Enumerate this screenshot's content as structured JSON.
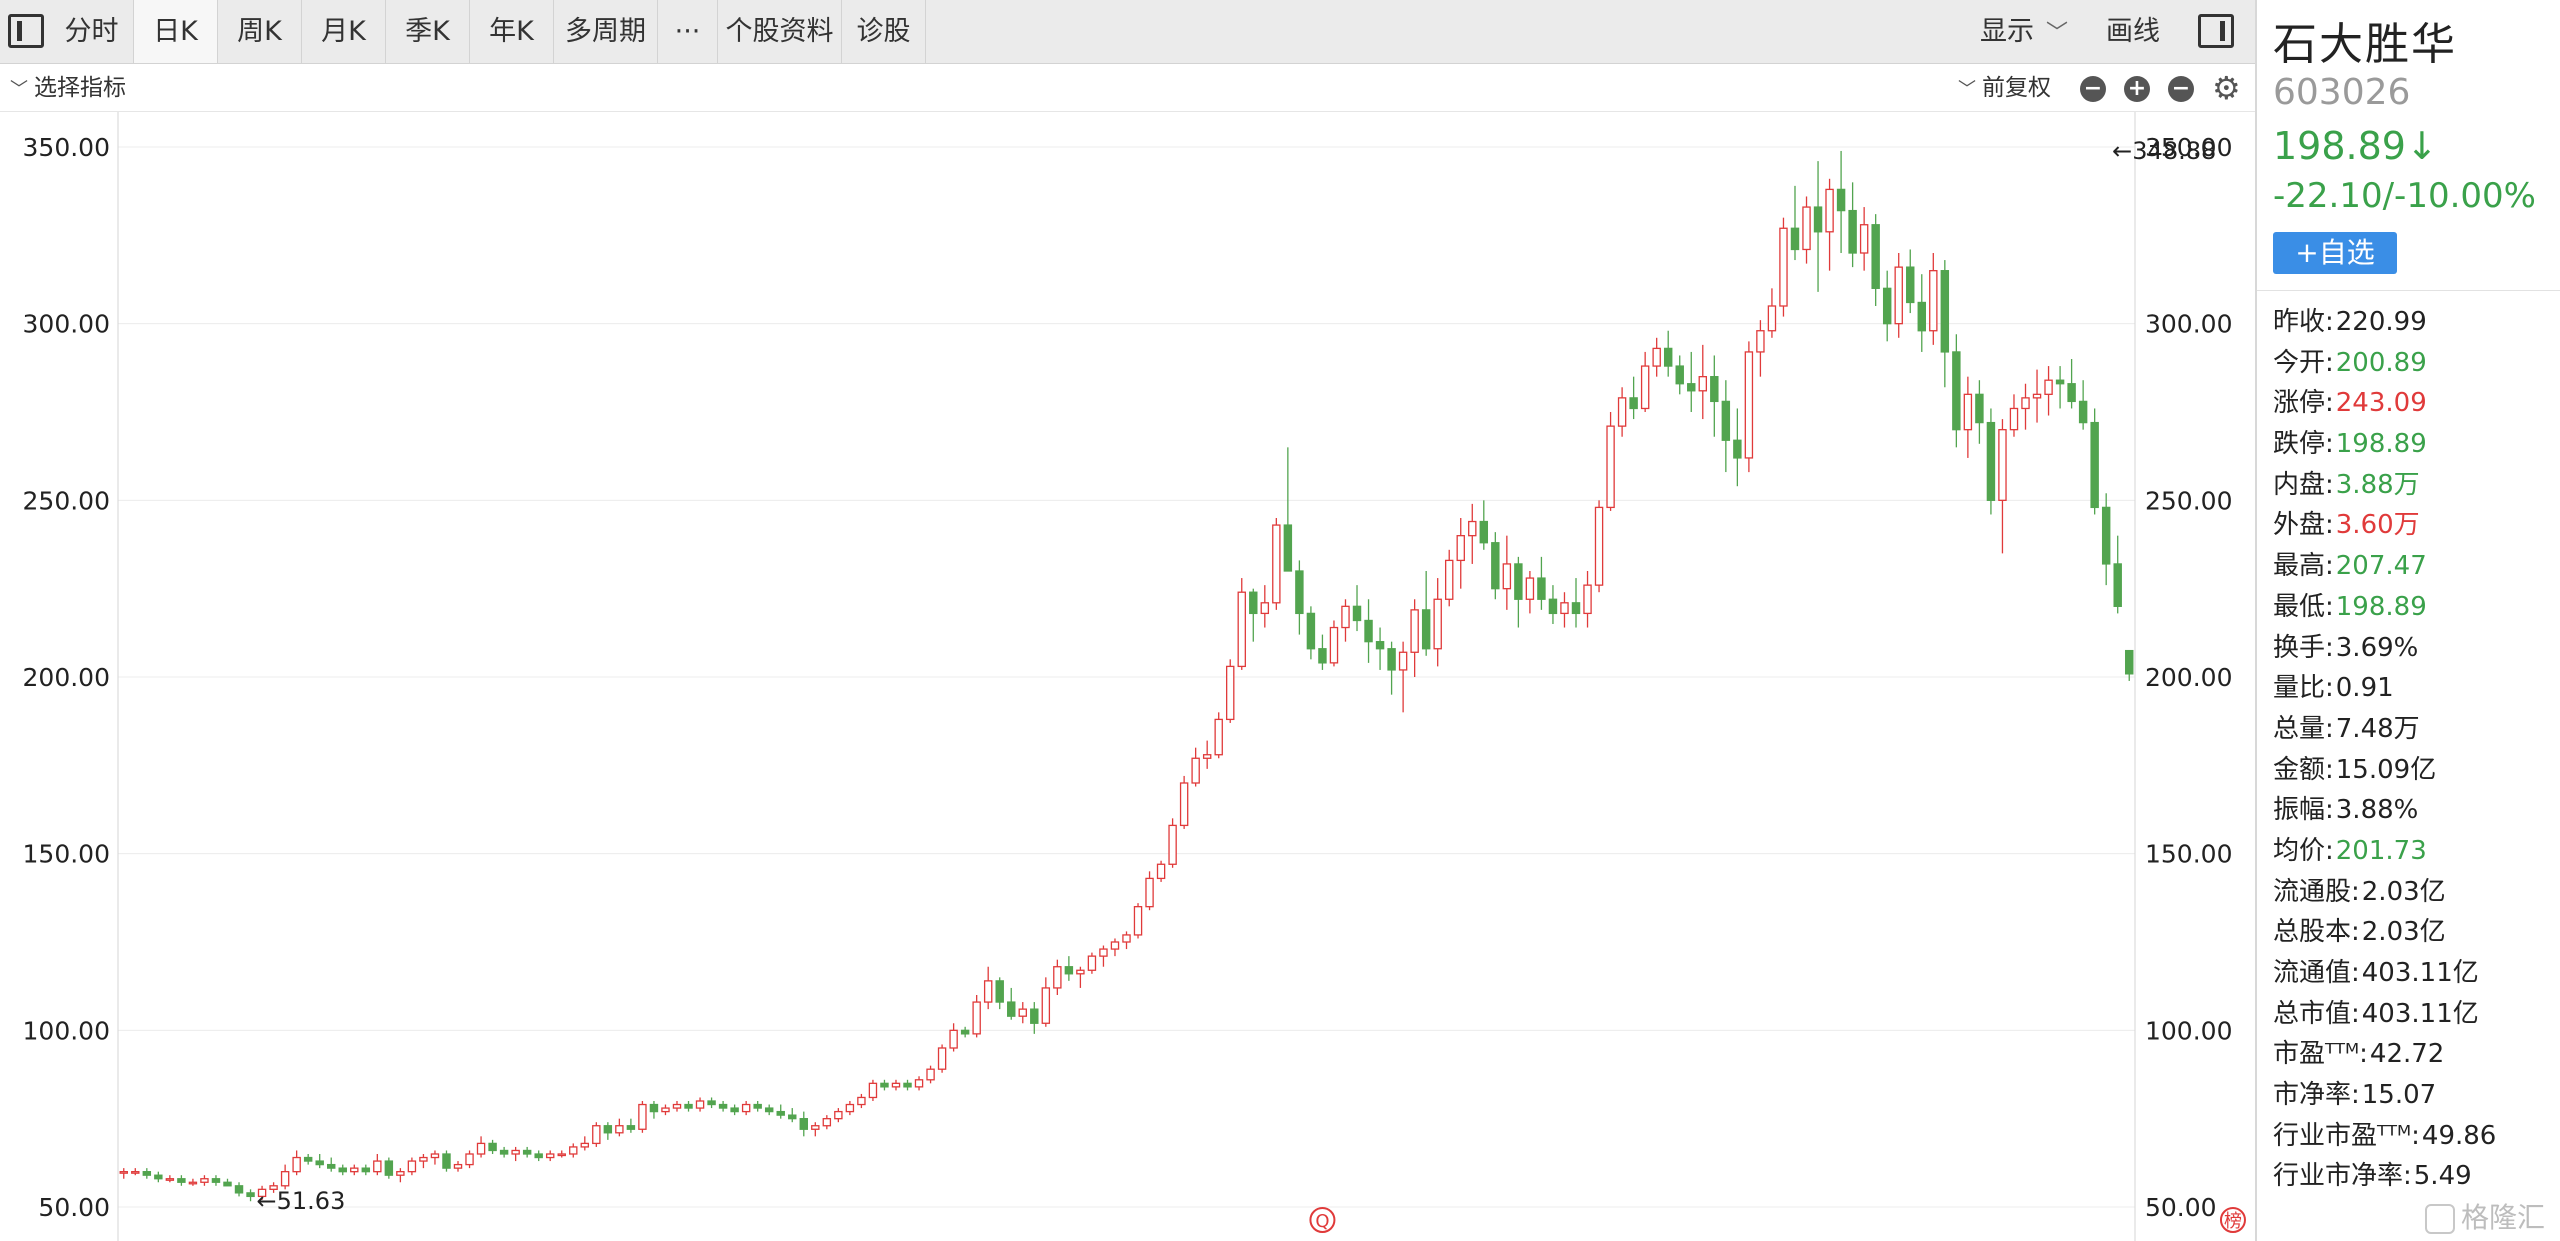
{
  "tabs": [
    {
      "label": "分时",
      "active": false
    },
    {
      "label": "日K",
      "active": true
    },
    {
      "label": "周K",
      "active": false
    },
    {
      "label": "月K",
      "active": false
    },
    {
      "label": "季K",
      "active": false
    },
    {
      "label": "年K",
      "active": false
    },
    {
      "label": "多周期",
      "active": false
    },
    {
      "label": "···",
      "active": false
    },
    {
      "label": "个股资料",
      "active": false
    },
    {
      "label": "诊股",
      "active": false
    }
  ],
  "toolbar": {
    "display_label": "显示",
    "draw_label": "画线",
    "indicator_label": "选择指标",
    "adjust_label": "前复权"
  },
  "stock": {
    "name": "石大胜华",
    "code": "603026",
    "price": "198.89↓",
    "change": "-22.10/-10.00%",
    "add_label": "+自选"
  },
  "stats": [
    {
      "label": "昨收:",
      "value": "220.99",
      "color": "dark"
    },
    {
      "label": "今开:",
      "value": "200.89",
      "color": "green"
    },
    {
      "label": "涨停:",
      "value": "243.09",
      "color": "red"
    },
    {
      "label": "跌停:",
      "value": "198.89",
      "color": "green"
    },
    {
      "label": "内盘:",
      "value": "3.88万",
      "color": "green"
    },
    {
      "label": "外盘:",
      "value": "3.60万",
      "color": "red"
    },
    {
      "label": "最高:",
      "value": "207.47",
      "color": "green"
    },
    {
      "label": "最低:",
      "value": "198.89",
      "color": "green"
    },
    {
      "label": "换手:",
      "value": "3.69%",
      "color": "dark"
    },
    {
      "label": "量比:",
      "value": "0.91",
      "color": "dark"
    },
    {
      "label": "总量:",
      "value": "7.48万",
      "color": "dark"
    },
    {
      "label": "金额:",
      "value": "15.09亿",
      "color": "dark"
    },
    {
      "label": "振幅:",
      "value": "3.88%",
      "color": "dark"
    },
    {
      "label": "均价:",
      "value": "201.73",
      "color": "green"
    },
    {
      "label": "流通股:",
      "value": "2.03亿",
      "color": "dark"
    },
    {
      "label": "总股本:",
      "value": "2.03亿",
      "color": "dark"
    },
    {
      "label": "流通值:",
      "value": "403.11亿",
      "color": "dark"
    },
    {
      "label": "总市值:",
      "value": "403.11亿",
      "color": "dark"
    },
    {
      "label": "市盈ᵀᵀᴹ:",
      "value": "42.72",
      "color": "dark"
    },
    {
      "label": "市净率:",
      "value": "15.07",
      "color": "dark"
    },
    {
      "label": "行业市盈ᵀᵀᴹ:",
      "value": "49.86",
      "color": "dark"
    },
    {
      "label": "行业市净率:",
      "value": "5.49",
      "color": "dark"
    }
  ],
  "colors": {
    "up": "#e03a3a",
    "down": "#52a44f",
    "button": "#3a8ee6"
  },
  "watermark": "格隆汇",
  "chart_data": {
    "type": "candlestick",
    "ylim": [
      50,
      350
    ],
    "yticks": [
      "350.00",
      "300.00",
      "250.00",
      "200.00",
      "150.00",
      "100.00",
      "50.00"
    ],
    "ytick_values": [
      350,
      300,
      250,
      200,
      150,
      100,
      50
    ],
    "annotations": [
      {
        "text": "←348.88",
        "value": 348.88,
        "index": 172
      },
      {
        "text": "←51.63",
        "value": 51.63,
        "index": 11
      }
    ],
    "markers": [
      {
        "text": "Q",
        "index": 104
      },
      {
        "text": "榜",
        "index": 183
      }
    ],
    "candles": [
      [
        60,
        61,
        58,
        60
      ],
      [
        60,
        61,
        59,
        60
      ],
      [
        60,
        61,
        58,
        59
      ],
      [
        59,
        60,
        57,
        58
      ],
      [
        58,
        59,
        57,
        58
      ],
      [
        58,
        59,
        56,
        57
      ],
      [
        57,
        58,
        56,
        57
      ],
      [
        57,
        59,
        56,
        58
      ],
      [
        58,
        59,
        56,
        57
      ],
      [
        57,
        58,
        56,
        56
      ],
      [
        56,
        57,
        53,
        54
      ],
      [
        54,
        55,
        51.63,
        53
      ],
      [
        53,
        56,
        52,
        55
      ],
      [
        55,
        57,
        54,
        56
      ],
      [
        56,
        62,
        55,
        60
      ],
      [
        60,
        66,
        59,
        64
      ],
      [
        64,
        65,
        62,
        63
      ],
      [
        63,
        65,
        61,
        62
      ],
      [
        62,
        64,
        60,
        61
      ],
      [
        61,
        62,
        59,
        60
      ],
      [
        60,
        62,
        59,
        61
      ],
      [
        61,
        62,
        59,
        60
      ],
      [
        60,
        65,
        59,
        63
      ],
      [
        63,
        64,
        58,
        59
      ],
      [
        59,
        61,
        57,
        60
      ],
      [
        60,
        64,
        59,
        63
      ],
      [
        63,
        65,
        61,
        64
      ],
      [
        64,
        66,
        62,
        65
      ],
      [
        65,
        66,
        60,
        61
      ],
      [
        61,
        63,
        60,
        62
      ],
      [
        62,
        66,
        61,
        65
      ],
      [
        65,
        70,
        64,
        68
      ],
      [
        68,
        69,
        65,
        66
      ],
      [
        66,
        67,
        64,
        65
      ],
      [
        65,
        67,
        63,
        66
      ],
      [
        66,
        67,
        64,
        65
      ],
      [
        65,
        66,
        63,
        64
      ],
      [
        64,
        66,
        63,
        65
      ],
      [
        65,
        66,
        64,
        65
      ],
      [
        65,
        68,
        64,
        67
      ],
      [
        67,
        70,
        66,
        68
      ],
      [
        68,
        74,
        67,
        73
      ],
      [
        73,
        74,
        69,
        71
      ],
      [
        71,
        75,
        70,
        73
      ],
      [
        73,
        75,
        71,
        72
      ],
      [
        72,
        80,
        71,
        79
      ],
      [
        79,
        80,
        75,
        77
      ],
      [
        77,
        79,
        76,
        78
      ],
      [
        78,
        80,
        77,
        79
      ],
      [
        79,
        80,
        77,
        78
      ],
      [
        78,
        81,
        77,
        80
      ],
      [
        80,
        81,
        78,
        79
      ],
      [
        79,
        80,
        77,
        78
      ],
      [
        78,
        79,
        76,
        77
      ],
      [
        77,
        80,
        76,
        79
      ],
      [
        79,
        80,
        77,
        78
      ],
      [
        78,
        79,
        76,
        77
      ],
      [
        77,
        79,
        75,
        76
      ],
      [
        76,
        78,
        74,
        75
      ],
      [
        75,
        77,
        70,
        72
      ],
      [
        72,
        74,
        70,
        73
      ],
      [
        73,
        76,
        72,
        75
      ],
      [
        75,
        78,
        74,
        77
      ],
      [
        77,
        80,
        76,
        79
      ],
      [
        79,
        82,
        78,
        81
      ],
      [
        81,
        86,
        80,
        85
      ],
      [
        85,
        86,
        83,
        84
      ],
      [
        84,
        86,
        83,
        85
      ],
      [
        85,
        86,
        83,
        84
      ],
      [
        84,
        87,
        83,
        86
      ],
      [
        86,
        90,
        85,
        89
      ],
      [
        89,
        96,
        88,
        95
      ],
      [
        95,
        102,
        94,
        100
      ],
      [
        100,
        101,
        98,
        99
      ],
      [
        99,
        110,
        98,
        108
      ],
      [
        108,
        118,
        106,
        114
      ],
      [
        114,
        115,
        106,
        108
      ],
      [
        108,
        112,
        103,
        104
      ],
      [
        104,
        108,
        102,
        106
      ],
      [
        106,
        108,
        99,
        102
      ],
      [
        102,
        115,
        101,
        112
      ],
      [
        112,
        120,
        110,
        118
      ],
      [
        118,
        121,
        114,
        116
      ],
      [
        116,
        118,
        112,
        117
      ],
      [
        117,
        122,
        116,
        121
      ],
      [
        121,
        124,
        118,
        123
      ],
      [
        123,
        126,
        121,
        125
      ],
      [
        125,
        128,
        123,
        127
      ],
      [
        127,
        136,
        126,
        135
      ],
      [
        135,
        145,
        134,
        143
      ],
      [
        143,
        148,
        142,
        147
      ],
      [
        147,
        160,
        146,
        158
      ],
      [
        158,
        172,
        157,
        170
      ],
      [
        170,
        180,
        169,
        177
      ],
      [
        177,
        182,
        174,
        178
      ],
      [
        178,
        190,
        177,
        188
      ],
      [
        188,
        205,
        187,
        203
      ],
      [
        203,
        228,
        202,
        224
      ],
      [
        224,
        225,
        210,
        218
      ],
      [
        218,
        226,
        214,
        221
      ],
      [
        221,
        245,
        219,
        243
      ],
      [
        243,
        265,
        232,
        230
      ],
      [
        230,
        233,
        212,
        218
      ],
      [
        218,
        220,
        205,
        208
      ],
      [
        208,
        212,
        202,
        204
      ],
      [
        204,
        216,
        203,
        214
      ],
      [
        214,
        222,
        210,
        220
      ],
      [
        220,
        226,
        213,
        216
      ],
      [
        216,
        222,
        204,
        210
      ],
      [
        210,
        214,
        202,
        208
      ],
      [
        208,
        210,
        195,
        202
      ],
      [
        202,
        210,
        190,
        207
      ],
      [
        207,
        222,
        200,
        219
      ],
      [
        219,
        230,
        206,
        208
      ],
      [
        208,
        228,
        203,
        222
      ],
      [
        222,
        236,
        220,
        233
      ],
      [
        233,
        245,
        225,
        240
      ],
      [
        240,
        249,
        232,
        244
      ],
      [
        244,
        250,
        236,
        238
      ],
      [
        238,
        241,
        222,
        225
      ],
      [
        225,
        240,
        219,
        232
      ],
      [
        232,
        234,
        214,
        222
      ],
      [
        222,
        230,
        218,
        228
      ],
      [
        228,
        234,
        219,
        222
      ],
      [
        222,
        226,
        215,
        218
      ],
      [
        218,
        224,
        214,
        221
      ],
      [
        221,
        228,
        214,
        218
      ],
      [
        218,
        230,
        214,
        226
      ],
      [
        226,
        250,
        224,
        248
      ],
      [
        248,
        275,
        247,
        271
      ],
      [
        271,
        282,
        268,
        279
      ],
      [
        279,
        285,
        273,
        276
      ],
      [
        276,
        292,
        275,
        288
      ],
      [
        288,
        296,
        285,
        293
      ],
      [
        293,
        298,
        285,
        288
      ],
      [
        288,
        291,
        280,
        283
      ],
      [
        283,
        292,
        275,
        281
      ],
      [
        281,
        294,
        273,
        285
      ],
      [
        285,
        291,
        268,
        278
      ],
      [
        278,
        284,
        258,
        267
      ],
      [
        267,
        276,
        254,
        262
      ],
      [
        262,
        295,
        258,
        292
      ],
      [
        292,
        301,
        285,
        298
      ],
      [
        298,
        310,
        296,
        305
      ],
      [
        305,
        330,
        302,
        327
      ],
      [
        327,
        339,
        318,
        321
      ],
      [
        321,
        336,
        317,
        333
      ],
      [
        333,
        346,
        309,
        326
      ],
      [
        326,
        341,
        315,
        338
      ],
      [
        338,
        348.88,
        320,
        332
      ],
      [
        332,
        340,
        316,
        320
      ],
      [
        320,
        333,
        315,
        328
      ],
      [
        328,
        331,
        305,
        310
      ],
      [
        310,
        315,
        295,
        300
      ],
      [
        300,
        320,
        296,
        316
      ],
      [
        316,
        321,
        303,
        306
      ],
      [
        306,
        314,
        292,
        298
      ],
      [
        298,
        320,
        294,
        315
      ],
      [
        315,
        318,
        282,
        292
      ],
      [
        292,
        297,
        265,
        270
      ],
      [
        270,
        285,
        262,
        280
      ],
      [
        280,
        284,
        266,
        272
      ],
      [
        272,
        276,
        246,
        250
      ],
      [
        250,
        273,
        235,
        270
      ],
      [
        270,
        280,
        268,
        276
      ],
      [
        276,
        283,
        270,
        279
      ],
      [
        279,
        287,
        272,
        280
      ],
      [
        280,
        288,
        274,
        284
      ],
      [
        284,
        288,
        276,
        283
      ],
      [
        283,
        290,
        276,
        278
      ],
      [
        278,
        284,
        270,
        272
      ],
      [
        272,
        276,
        246,
        248
      ],
      [
        248,
        252,
        226,
        232
      ],
      [
        232,
        240,
        218,
        220
      ],
      [
        207.47,
        207.47,
        198.89,
        200.89
      ]
    ]
  }
}
